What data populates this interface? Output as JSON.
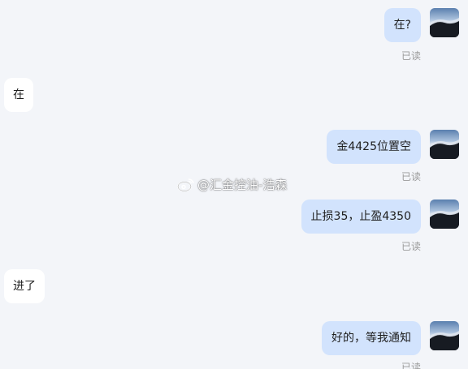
{
  "messages": [
    {
      "side": "right",
      "text": "在?",
      "status": "已读"
    },
    {
      "side": "left",
      "text": "在"
    },
    {
      "side": "right",
      "text": "金4425位置空",
      "status": "已读"
    },
    {
      "side": "right",
      "text": "止损35，止盈4350",
      "status": "已读"
    },
    {
      "side": "left",
      "text": "进了"
    },
    {
      "side": "right",
      "text": "好的，等我通知",
      "status": "已读"
    }
  ],
  "watermark": {
    "text": "@汇金控油-浩森",
    "icon": "weibo-icon"
  },
  "colors": {
    "background": "#f3f5f9",
    "sent_bubble": "#d2e3fd",
    "received_bubble": "#ffffff",
    "read_text": "#9a9a9a"
  }
}
